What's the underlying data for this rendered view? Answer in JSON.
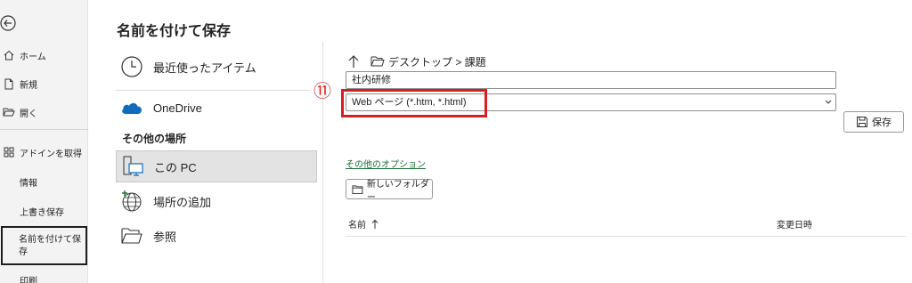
{
  "nav": {
    "items": [
      {
        "label": "ホーム"
      },
      {
        "label": "新規"
      },
      {
        "label": "開く"
      },
      {
        "label": "アドインを取得"
      },
      {
        "label": "情報"
      },
      {
        "label": "上書き保存"
      },
      {
        "label": "名前を付けて保存"
      },
      {
        "label": "印刷"
      }
    ]
  },
  "page": {
    "title": "名前を付けて保存"
  },
  "locations": {
    "recent": "最近使ったアイテム",
    "onedrive": "OneDrive",
    "section": "その他の場所",
    "this_pc": "この PC",
    "add_place": "場所の追加",
    "browse": "参照"
  },
  "breadcrumb": {
    "path": "デスクトップ > 課題"
  },
  "annotation": {
    "step": "⑪"
  },
  "file": {
    "name": "社内研修",
    "type": "Web ページ (*.htm, *.html)"
  },
  "buttons": {
    "save": "保存",
    "more_options": "その他のオプション",
    "new_folder": "新しいフォルダー"
  },
  "columns": {
    "name": "名前",
    "modified": "変更日時"
  },
  "colors": {
    "accent_green": "#1a6e34",
    "highlight_red": "#d32020",
    "onedrive_blue": "#0f6cbd"
  }
}
